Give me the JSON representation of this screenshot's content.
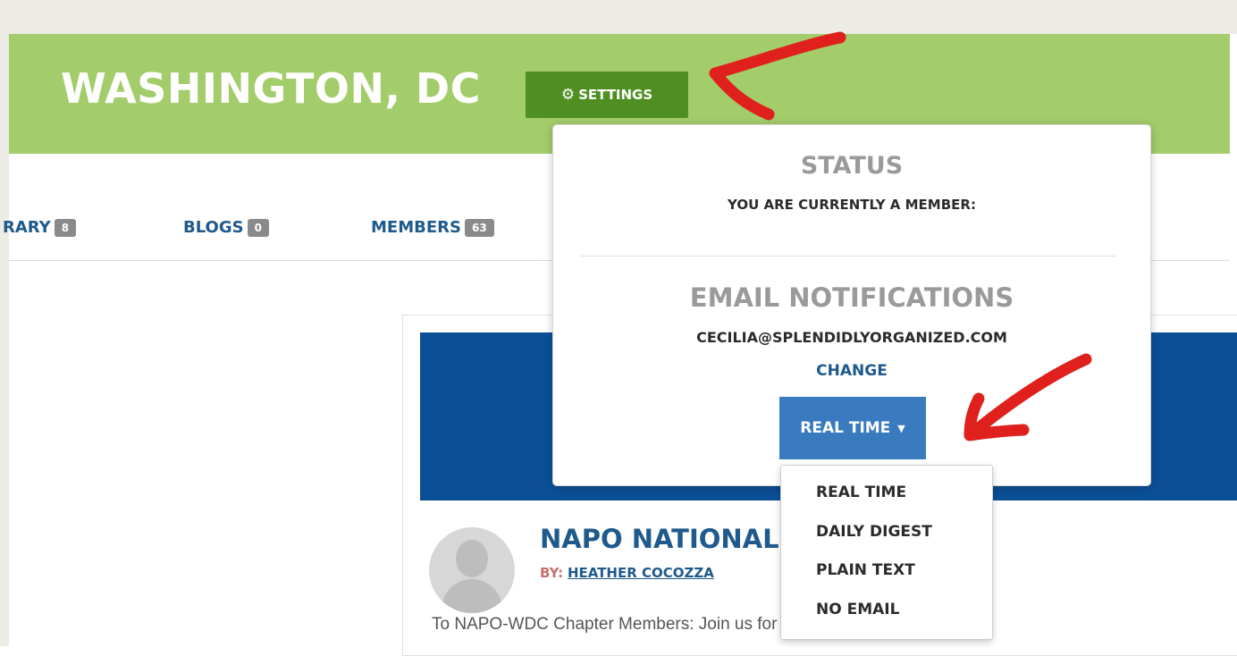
{
  "group": {
    "title": "WASHINGTON, DC"
  },
  "settings": {
    "label": "SETTINGS",
    "icon": "gear-icon"
  },
  "tabs": [
    {
      "label": "RARY",
      "count": "8"
    },
    {
      "label": "BLOGS",
      "count": "0"
    },
    {
      "label": "MEMBERS",
      "count": "63"
    }
  ],
  "popover": {
    "status_title": "STATUS",
    "status_text": "YOU ARE CURRENTLY A MEMBER:",
    "email_title": "EMAIL NOTIFICATIONS",
    "email": "CECILIA@SPLENDIDLYORGANIZED.COM",
    "change_label": "CHANGE",
    "frequency_selected": "REAL TIME"
  },
  "dropdown": {
    "options": [
      "REAL TIME",
      "DAILY DIGEST",
      "PLAIN TEXT",
      "NO EMAIL"
    ]
  },
  "post": {
    "title": "NAPO NATIONAL",
    "by_prefix": "BY:",
    "author": "HEATHER COCOZZA",
    "excerpt": "To NAPO-WDC Chapter Members: Join us for a conference call with a"
  },
  "annotation_color": "#e0201c"
}
